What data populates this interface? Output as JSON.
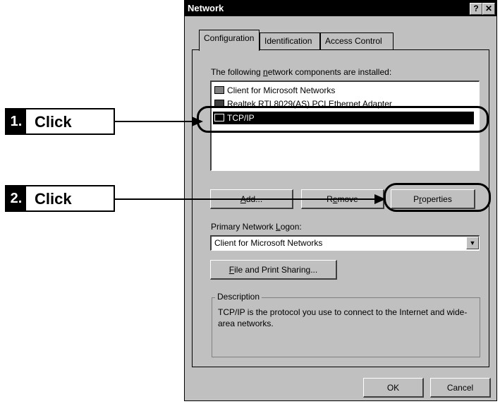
{
  "window": {
    "title": "Network",
    "help_button": "?",
    "close_button": "✕"
  },
  "tabs": [
    {
      "label": "Configuration"
    },
    {
      "label": "Identification"
    },
    {
      "label": "Access Control"
    }
  ],
  "components": {
    "heading_prefix": "The following ",
    "heading_underline": "n",
    "heading_suffix": "etwork components are installed:",
    "items": [
      {
        "label": "Client for Microsoft Networks",
        "icon": "client-icon"
      },
      {
        "label": "Realtek RTL8029(AS) PCI Ethernet Adapter",
        "icon": "network-adapter-icon"
      },
      {
        "label": "TCP/IP",
        "icon": "protocol-icon",
        "selected": true
      }
    ]
  },
  "buttons": {
    "add_u": "A",
    "add_rest": "dd...",
    "remove_pre": "R",
    "remove_u": "e",
    "remove_rest": "move",
    "properties_pre": "P",
    "properties_u": "r",
    "properties_rest": "operties",
    "file_sharing_u": "F",
    "file_sharing_rest": "ile and Print Sharing...",
    "ok": "OK",
    "cancel": "Cancel"
  },
  "logon": {
    "label_prefix": "Primary Network ",
    "label_underline": "L",
    "label_suffix": "ogon:",
    "value": "Client for Microsoft Networks"
  },
  "description": {
    "legend": "Description",
    "text": "TCP/IP is the protocol you use to connect to the Internet and wide-area networks."
  },
  "callouts": [
    {
      "number": "1.",
      "text": "Click"
    },
    {
      "number": "2.",
      "text": "Click"
    }
  ]
}
